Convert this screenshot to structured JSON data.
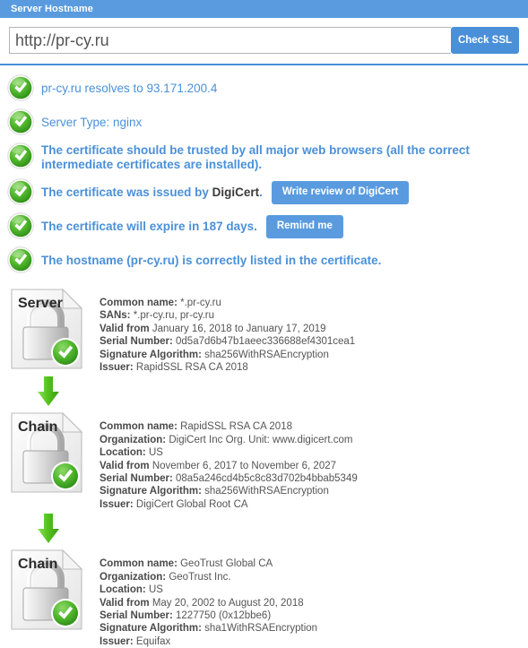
{
  "panel": {
    "header_title": "Server Hostname"
  },
  "search": {
    "value": "http://pr-cy.ru",
    "placeholder": "http://pr-cy.ru",
    "button_label": "Check SSL"
  },
  "colors": {
    "header_blue": "#5a9bdf",
    "accent_blue": "#4a90d9",
    "text_blue": "#4a90d9",
    "check_green": "#4caf2f",
    "detail_gray": "#555555"
  },
  "status_items": [
    {
      "icon": "green-check-icon",
      "text": "pr-cy.ru resolves to 93.171.200.4",
      "bold": false,
      "button": null
    },
    {
      "icon": "green-check-icon",
      "text": "Server Type: nginx",
      "bold": false,
      "button": null
    },
    {
      "icon": "green-check-icon",
      "text": "The certificate should be trusted by all major web browsers (all the correct intermediate certificates are installed).",
      "bold": true,
      "button": null
    },
    {
      "icon": "green-check-icon",
      "text_before": "The certificate was issued by ",
      "emphasis": "DigiCert",
      "text_after": ".",
      "bold": true,
      "button": "Write review of DigiCert"
    },
    {
      "icon": "green-check-icon",
      "text": "The certificate will expire in 187 days.",
      "bold": true,
      "button": "Remind me"
    },
    {
      "icon": "green-check-icon",
      "text": "The hostname (pr-cy.ru) is correctly listed in the certificate.",
      "bold": true,
      "button": null
    }
  ],
  "chain": [
    {
      "icon_label": "Server",
      "icon": "certificate-lock-icon",
      "lines": [
        {
          "label": "Common name:",
          "value": "*.pr-cy.ru"
        },
        {
          "label": "SANs:",
          "value": "*.pr-cy.ru, pr-cy.ru"
        },
        {
          "label": "Valid from",
          "value": "January 16, 2018 to January 17, 2019"
        },
        {
          "label": "Serial Number:",
          "value": "0d5a7d6b47b1aeec336688ef4301cea1"
        },
        {
          "label": "Signature Algorithm:",
          "value": "sha256WithRSAEncryption"
        },
        {
          "label": "Issuer:",
          "value": "RapidSSL RSA CA 2018"
        }
      ]
    },
    {
      "icon_label": "Chain",
      "icon": "certificate-lock-icon",
      "lines": [
        {
          "label": "Common name:",
          "value": "RapidSSL RSA CA 2018"
        },
        {
          "label": "Organization:",
          "value": "DigiCert Inc Org. Unit: www.digicert.com"
        },
        {
          "label": "Location:",
          "value": "US"
        },
        {
          "label": "Valid from",
          "value": "November 6, 2017 to November 6, 2027"
        },
        {
          "label": "Serial Number:",
          "value": "08a5a246cd4b5c8c83d702b4bbab5349"
        },
        {
          "label": "Signature Algorithm:",
          "value": "sha256WithRSAEncryption"
        },
        {
          "label": "Issuer:",
          "value": "DigiCert Global Root CA"
        }
      ]
    },
    {
      "icon_label": "Chain",
      "icon": "certificate-lock-icon",
      "lines": [
        {
          "label": "Common name:",
          "value": "GeoTrust Global CA"
        },
        {
          "label": "Organization:",
          "value": "GeoTrust Inc."
        },
        {
          "label": "Location:",
          "value": "US"
        },
        {
          "label": "Valid from",
          "value": "May 20, 2002 to August 20, 2018"
        },
        {
          "label": "Serial Number:",
          "value": "1227750 (0x12bbe6)"
        },
        {
          "label": "Signature Algorithm:",
          "value": "sha1WithRSAEncryption"
        },
        {
          "label": "Issuer:",
          "value": "Equifax"
        }
      ]
    }
  ],
  "connector_icon": "green-down-arrow-icon"
}
